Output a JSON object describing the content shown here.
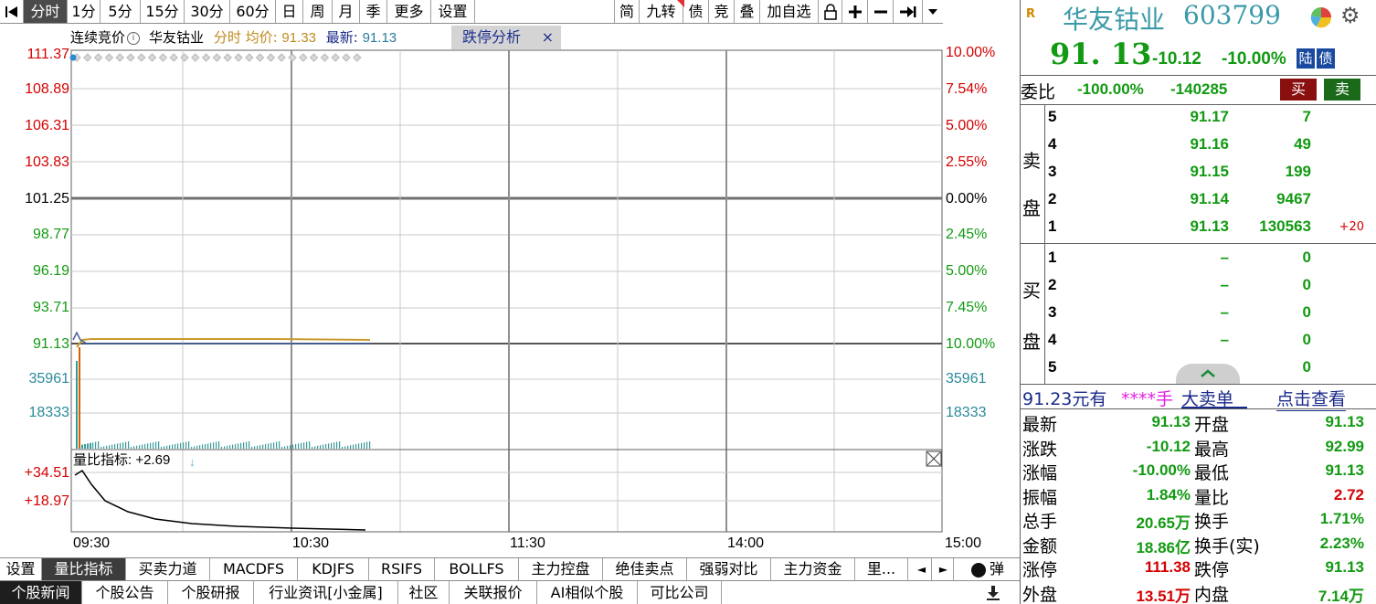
{
  "toolbar": {
    "items": [
      "分时",
      "1分",
      "5分",
      "15分",
      "30分",
      "60分",
      "日",
      "周",
      "月",
      "季",
      "更多",
      "设置"
    ],
    "right_items": [
      "简",
      "九转",
      "债",
      "竞",
      "叠",
      "加自选"
    ]
  },
  "infobar": {
    "phase": "连续竞价",
    "stock": "华友钴业",
    "avg_label": "分时 均价:",
    "avg_value": "91.33",
    "last_label": "最新:",
    "last_value": "91.13"
  },
  "limit_panel_label": "跌停分析",
  "left_axis": [
    "111.37",
    "108.89",
    "106.31",
    "103.83",
    "101.25",
    "98.77",
    "96.19",
    "93.71",
    "91.13",
    "35961",
    "18333"
  ],
  "right_axis": [
    "10.00%",
    "7.54%",
    "5.00%",
    "2.55%",
    "0.00%",
    "2.45%",
    "5.00%",
    "7.45%",
    "10.00%",
    "35961",
    "18333"
  ],
  "indicator": {
    "label": "量比指标: +2.69",
    "axis": [
      "+34.51",
      "+18.97"
    ]
  },
  "time_axis": [
    "09:30",
    "10:30",
    "11:30",
    "14:00",
    "15:00"
  ],
  "indicator_tabs": [
    "设置",
    "量比指标",
    "买卖力道",
    "MACDFS",
    "KDJFS",
    "RSIFS",
    "BOLLFS",
    "主力控盘",
    "绝佳卖点",
    "强弱对比",
    "主力资金",
    "里..."
  ],
  "bounce_label": "弹",
  "news_tabs": [
    "个股新闻",
    "个股公告",
    "个股研报",
    "行业资讯[小金属]",
    "社区",
    "关联报价",
    "AI相似个股",
    "可比公司"
  ],
  "quote": {
    "name": "华友钴业",
    "code": "603799",
    "price": "91. 13",
    "change": "-10.12",
    "change_pct": "-10.00%",
    "tags": [
      "陆",
      "债"
    ],
    "ratio_label": "委比",
    "ratio_pct": "-100.00%",
    "ratio_diff": "-140285",
    "buy_btn": "买",
    "sell_btn": "卖",
    "sell_side": "卖盘",
    "buy_side": "买盘",
    "asks": [
      {
        "lvl": "5",
        "price": "91.17",
        "vol": "7",
        "delta": ""
      },
      {
        "lvl": "4",
        "price": "91.16",
        "vol": "49",
        "delta": ""
      },
      {
        "lvl": "3",
        "price": "91.15",
        "vol": "199",
        "delta": ""
      },
      {
        "lvl": "2",
        "price": "91.14",
        "vol": "9467",
        "delta": ""
      },
      {
        "lvl": "1",
        "price": "91.13",
        "vol": "130563",
        "delta": "+20"
      }
    ],
    "bids": [
      {
        "lvl": "1",
        "price": "–",
        "vol": "0"
      },
      {
        "lvl": "2",
        "price": "–",
        "vol": "0"
      },
      {
        "lvl": "3",
        "price": "–",
        "vol": "0"
      },
      {
        "lvl": "4",
        "price": "–",
        "vol": "0"
      },
      {
        "lvl": "5",
        "price": "–",
        "vol": "0"
      }
    ],
    "big_order": {
      "price_text": "91.23元有",
      "stars": "****手",
      "label": "大卖单",
      "link": "点击查看"
    },
    "stats": [
      {
        "l1": "最新",
        "v1": "91.13",
        "c1": "green",
        "l2": "开盘",
        "v2": "91.13",
        "c2": "green"
      },
      {
        "l1": "涨跌",
        "v1": "-10.12",
        "c1": "green",
        "l2": "最高",
        "v2": "92.99",
        "c2": "green"
      },
      {
        "l1": "涨幅",
        "v1": "-10.00%",
        "c1": "green",
        "l2": "最低",
        "v2": "91.13",
        "c2": "green"
      },
      {
        "l1": "振幅",
        "v1": "1.84%",
        "c1": "green",
        "l2": "量比",
        "v2": "2.72",
        "c2": "red"
      },
      {
        "l1": "总手",
        "v1": "20.65万",
        "c1": "green",
        "l2": "换手",
        "v2": "1.71%",
        "c2": "green"
      },
      {
        "l1": "金额",
        "v1": "18.86亿",
        "c1": "green",
        "l2": "换手(实)",
        "v2": "2.23%",
        "c2": "green"
      },
      {
        "l1": "涨停",
        "v1": "111.38",
        "c1": "red",
        "l2": "跌停",
        "v2": "91.13",
        "c2": "green"
      },
      {
        "l1": "外盘",
        "v1": "13.51万",
        "c1": "red",
        "l2": "内盘",
        "v2": "7.14万",
        "c2": "green"
      }
    ]
  },
  "colors": {
    "up": "#d40000",
    "down": "#129a12",
    "price_line": "#404040",
    "avg_line": "#c89a30",
    "volume": "#3a9a9a",
    "cyan_axis": "#2a8a9a"
  }
}
